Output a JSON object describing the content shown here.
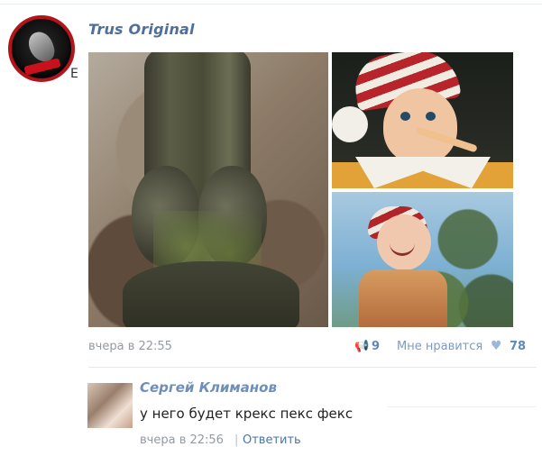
{
  "post": {
    "author": "Trus Original",
    "glyph": "Е",
    "time": "вчера в 22:55",
    "device_icon": "",
    "shares": "9",
    "like_label": "Мне нравится",
    "likes": "78"
  },
  "comment": {
    "author": "Сергей Климанов",
    "text": "у него будет крекс пекс фекс",
    "time": "вчера в 22:56",
    "separator": "|",
    "reply": "Ответить"
  },
  "colors": {
    "link": "#4a76a8",
    "muted": "#939aa3",
    "author": "#4e6f9c"
  }
}
